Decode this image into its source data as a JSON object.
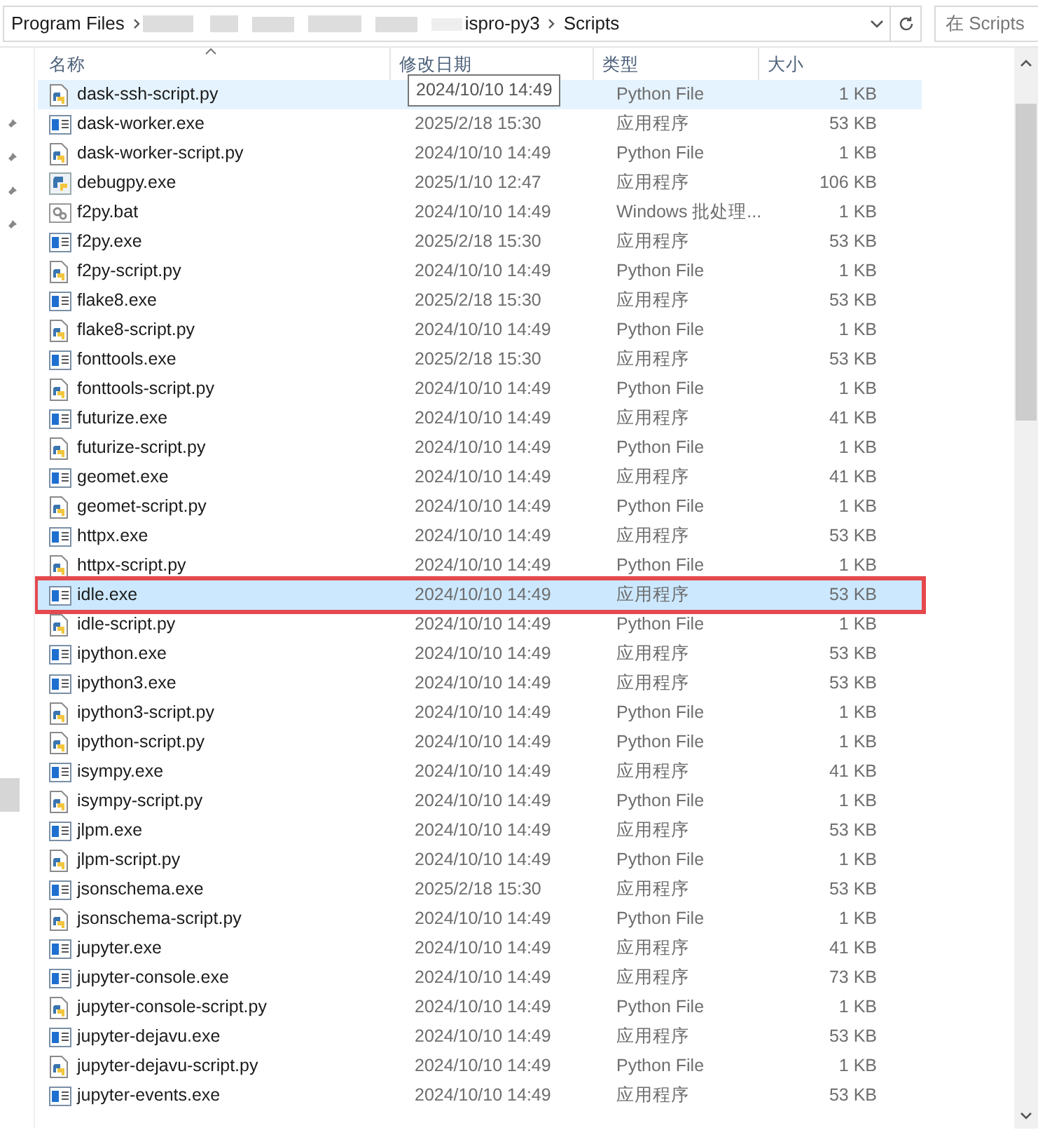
{
  "address_bar": {
    "crumbs": [
      "Program Files",
      "ispro-py3",
      "Scripts"
    ],
    "search": {
      "placeholder": "在 Scripts"
    }
  },
  "columns": [
    "名称",
    "修改日期",
    "类型",
    "大小"
  ],
  "tooltip": "2024/10/10 14:49",
  "rows": [
    {
      "kind": "py",
      "name": "dask-ssh-script.py",
      "type": "Python File",
      "size": "1 KB",
      "selected": false,
      "hover": true,
      "outlined": false
    },
    {
      "kind": "exe",
      "name": "dask-worker.exe",
      "date": "2025/2/18 15:30",
      "type": "应用程序",
      "size": "53 KB",
      "selected": false,
      "hover": false,
      "outlined": false
    },
    {
      "kind": "py",
      "name": "dask-worker-script.py",
      "date": "2024/10/10 14:49",
      "type": "Python File",
      "size": "1 KB",
      "selected": false,
      "hover": false,
      "outlined": false
    },
    {
      "kind": "pyexe",
      "name": "debugpy.exe",
      "date": "2025/1/10 12:47",
      "type": "应用程序",
      "size": "106 KB",
      "selected": false,
      "hover": false,
      "outlined": false
    },
    {
      "kind": "bat",
      "name": "f2py.bat",
      "date": "2024/10/10 14:49",
      "type": "Windows 批处理...",
      "size": "1 KB",
      "selected": false,
      "hover": false,
      "outlined": false
    },
    {
      "kind": "exe",
      "name": "f2py.exe",
      "date": "2025/2/18 15:30",
      "type": "应用程序",
      "size": "53 KB",
      "selected": false,
      "hover": false,
      "outlined": false
    },
    {
      "kind": "py",
      "name": "f2py-script.py",
      "date": "2024/10/10 14:49",
      "type": "Python File",
      "size": "1 KB",
      "selected": false,
      "hover": false,
      "outlined": false
    },
    {
      "kind": "exe",
      "name": "flake8.exe",
      "date": "2025/2/18 15:30",
      "type": "应用程序",
      "size": "53 KB",
      "selected": false,
      "hover": false,
      "outlined": false
    },
    {
      "kind": "py",
      "name": "flake8-script.py",
      "date": "2024/10/10 14:49",
      "type": "Python File",
      "size": "1 KB",
      "selected": false,
      "hover": false,
      "outlined": false
    },
    {
      "kind": "exe",
      "name": "fonttools.exe",
      "date": "2025/2/18 15:30",
      "type": "应用程序",
      "size": "53 KB",
      "selected": false,
      "hover": false,
      "outlined": false
    },
    {
      "kind": "py",
      "name": "fonttools-script.py",
      "date": "2024/10/10 14:49",
      "type": "Python File",
      "size": "1 KB",
      "selected": false,
      "hover": false,
      "outlined": false
    },
    {
      "kind": "exe",
      "name": "futurize.exe",
      "date": "2024/10/10 14:49",
      "type": "应用程序",
      "size": "41 KB",
      "selected": false,
      "hover": false,
      "outlined": false
    },
    {
      "kind": "py",
      "name": "futurize-script.py",
      "date": "2024/10/10 14:49",
      "type": "Python File",
      "size": "1 KB",
      "selected": false,
      "hover": false,
      "outlined": false
    },
    {
      "kind": "exe",
      "name": "geomet.exe",
      "date": "2024/10/10 14:49",
      "type": "应用程序",
      "size": "41 KB",
      "selected": false,
      "hover": false,
      "outlined": false
    },
    {
      "kind": "py",
      "name": "geomet-script.py",
      "date": "2024/10/10 14:49",
      "type": "Python File",
      "size": "1 KB",
      "selected": false,
      "hover": false,
      "outlined": false
    },
    {
      "kind": "exe",
      "name": "httpx.exe",
      "date": "2024/10/10 14:49",
      "type": "应用程序",
      "size": "53 KB",
      "selected": false,
      "hover": false,
      "outlined": false
    },
    {
      "kind": "py",
      "name": "httpx-script.py",
      "date": "2024/10/10 14:49",
      "type": "Python File",
      "size": "1 KB",
      "selected": false,
      "hover": false,
      "outlined": false
    },
    {
      "kind": "exe",
      "name": "idle.exe",
      "date": "2024/10/10 14:49",
      "type": "应用程序",
      "size": "53 KB",
      "selected": true,
      "hover": false,
      "outlined": true
    },
    {
      "kind": "py",
      "name": "idle-script.py",
      "date": "2024/10/10 14:49",
      "type": "Python File",
      "size": "1 KB",
      "selected": false,
      "hover": false,
      "outlined": false
    },
    {
      "kind": "exe",
      "name": "ipython.exe",
      "date": "2024/10/10 14:49",
      "type": "应用程序",
      "size": "53 KB",
      "selected": false,
      "hover": false,
      "outlined": false
    },
    {
      "kind": "exe",
      "name": "ipython3.exe",
      "date": "2024/10/10 14:49",
      "type": "应用程序",
      "size": "53 KB",
      "selected": false,
      "hover": false,
      "outlined": false
    },
    {
      "kind": "py",
      "name": "ipython3-script.py",
      "date": "2024/10/10 14:49",
      "type": "Python File",
      "size": "1 KB",
      "selected": false,
      "hover": false,
      "outlined": false
    },
    {
      "kind": "py",
      "name": "ipython-script.py",
      "date": "2024/10/10 14:49",
      "type": "Python File",
      "size": "1 KB",
      "selected": false,
      "hover": false,
      "outlined": false
    },
    {
      "kind": "exe",
      "name": "isympy.exe",
      "date": "2024/10/10 14:49",
      "type": "应用程序",
      "size": "41 KB",
      "selected": false,
      "hover": false,
      "outlined": false
    },
    {
      "kind": "py",
      "name": "isympy-script.py",
      "date": "2024/10/10 14:49",
      "type": "Python File",
      "size": "1 KB",
      "selected": false,
      "hover": false,
      "outlined": false
    },
    {
      "kind": "exe",
      "name": "jlpm.exe",
      "date": "2024/10/10 14:49",
      "type": "应用程序",
      "size": "53 KB",
      "selected": false,
      "hover": false,
      "outlined": false
    },
    {
      "kind": "py",
      "name": "jlpm-script.py",
      "date": "2024/10/10 14:49",
      "type": "Python File",
      "size": "1 KB",
      "selected": false,
      "hover": false,
      "outlined": false
    },
    {
      "kind": "exe",
      "name": "jsonschema.exe",
      "date": "2025/2/18 15:30",
      "type": "应用程序",
      "size": "53 KB",
      "selected": false,
      "hover": false,
      "outlined": false
    },
    {
      "kind": "py",
      "name": "jsonschema-script.py",
      "date": "2024/10/10 14:49",
      "type": "Python File",
      "size": "1 KB",
      "selected": false,
      "hover": false,
      "outlined": false
    },
    {
      "kind": "exe",
      "name": "jupyter.exe",
      "date": "2024/10/10 14:49",
      "type": "应用程序",
      "size": "41 KB",
      "selected": false,
      "hover": false,
      "outlined": false
    },
    {
      "kind": "exe",
      "name": "jupyter-console.exe",
      "date": "2024/10/10 14:49",
      "type": "应用程序",
      "size": "73 KB",
      "selected": false,
      "hover": false,
      "outlined": false
    },
    {
      "kind": "py",
      "name": "jupyter-console-script.py",
      "date": "2024/10/10 14:49",
      "type": "Python File",
      "size": "1 KB",
      "selected": false,
      "hover": false,
      "outlined": false
    },
    {
      "kind": "exe",
      "name": "jupyter-dejavu.exe",
      "date": "2024/10/10 14:49",
      "type": "应用程序",
      "size": "53 KB",
      "selected": false,
      "hover": false,
      "outlined": false
    },
    {
      "kind": "py",
      "name": "jupyter-dejavu-script.py",
      "date": "2024/10/10 14:49",
      "type": "Python File",
      "size": "1 KB",
      "selected": false,
      "hover": false,
      "outlined": false
    },
    {
      "kind": "exe",
      "name": "jupyter-events.exe",
      "date": "2024/10/10 14:49",
      "type": "应用程序",
      "size": "53 KB",
      "selected": false,
      "hover": false,
      "outlined": false
    }
  ]
}
